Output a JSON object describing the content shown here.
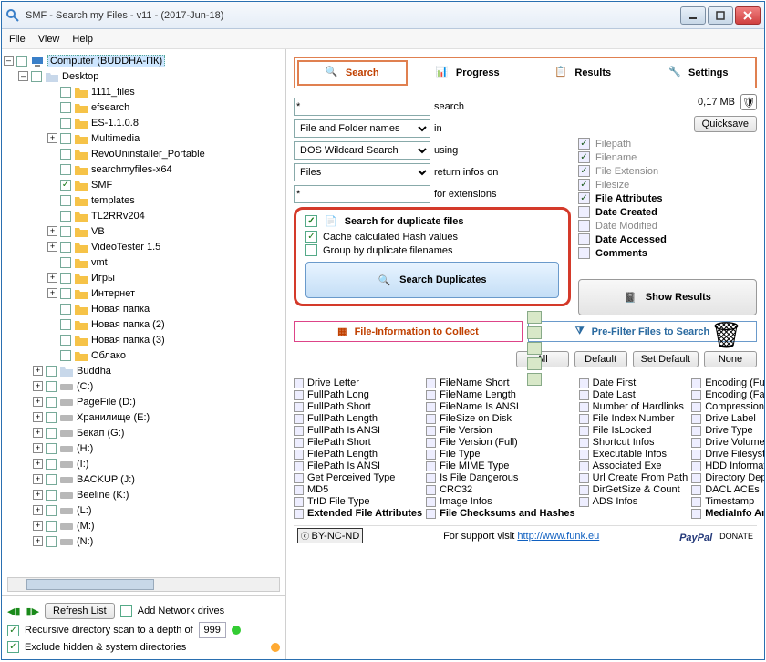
{
  "window": {
    "title": "SMF - Search my Files - v11 - (2017-Jun-18)"
  },
  "menu": {
    "file": "File",
    "view": "View",
    "help": "Help"
  },
  "tree": {
    "root": "Computer (BUDDHA-ПК)",
    "desktop": "Desktop",
    "folders": [
      "1111_files",
      "efsearch",
      "ES-1.1.0.8",
      "Multimedia",
      "RevoUninstaller_Portable",
      "searchmyfiles-x64",
      "SMF",
      "templates",
      "TL2RRv204",
      "VB",
      "VideoTester 1.5",
      "vmt",
      "Игры",
      "Интернет",
      "Новая папка",
      "Новая папка (2)",
      "Новая папка (3)",
      "Облако"
    ],
    "checked_folder": "SMF",
    "bottom": [
      "Buddha",
      "(C:)",
      "PageFile (D:)",
      "Хранилище (E:)",
      "Бекап (G:)",
      "(H:)",
      "(I:)",
      "BACKUP (J:)",
      "Beeline (K:)",
      "(L:)",
      "(M:)",
      "(N:)"
    ]
  },
  "left_bottom": {
    "refresh": "Refresh List",
    "add_net": "Add Network drives",
    "recursive": "Recursive directory scan to a depth of",
    "depth": "999",
    "exclude": "Exclude hidden & system directories"
  },
  "tabs": {
    "search": "Search",
    "progress": "Progress",
    "results": "Results",
    "settings": "Settings"
  },
  "search": {
    "pattern": "*",
    "lbl_search": "search",
    "in_opt": "File and Folder names",
    "lbl_in": "in",
    "using_opt": "DOS Wildcard Search",
    "lbl_using": "using",
    "return_opt": "Files",
    "lbl_return": "return infos on",
    "ext": "*",
    "lbl_ext": "for extensions"
  },
  "dup": {
    "head": "Search for duplicate files",
    "cache": "Cache calculated Hash values",
    "group": "Group by duplicate filenames",
    "btn": "Search Duplicates"
  },
  "checks": {
    "filepath": "Filepath",
    "filename": "Filename",
    "fileext": "File Extension",
    "filesize": "Filesize",
    "attrs": "File Attributes",
    "created": "Date Created",
    "modified": "Date Modified",
    "accessed": "Date Accessed",
    "comments": "Comments"
  },
  "topright": {
    "size": "0,17 MB",
    "quicksave": "Quicksave"
  },
  "show_results": "Show Results",
  "sections": {
    "collect": "File-Information to Collect",
    "prefilter": "Pre-Filter Files to Search"
  },
  "btns": {
    "all": "All",
    "default": "Default",
    "setdefault": "Set Default",
    "none": "None"
  },
  "grid": {
    "c1": [
      "Drive Letter",
      "FullPath Long",
      "FullPath Short",
      "FullPath Length",
      "FullPath Is ANSI",
      "FilePath Short",
      "FilePath Length",
      "FilePath Is ANSI",
      "Get Perceived Type",
      "MD5",
      "TrID File Type",
      "Extended File Attributes"
    ],
    "c2": [
      "FileName Short",
      "FileName Length",
      "FileName Is ANSI",
      "FileSize on Disk",
      "File Version",
      "File Version (Full)",
      "File Type",
      "File MIME Type",
      "Is File Dangerous",
      "CRC32",
      "Image Infos",
      "File Checksums and Hashes"
    ],
    "c3": [
      "Date First",
      "Date Last",
      "Number of Hardlinks",
      "File Index Number",
      "File IsLocked",
      "Shortcut Infos",
      "Executable Infos",
      "Associated Exe",
      "Url Create From Path",
      "DirGetSize & Count",
      "ADS Infos",
      ""
    ],
    "c4": [
      "Encoding (Full)",
      "Encoding (Fast)",
      "Compression State",
      "Drive Label",
      "Drive Type",
      "Drive Volume ID",
      "Drive Filesystem",
      "HDD Information",
      "Directory Depth",
      "DACL ACEs",
      "Timestamp",
      "MediaInfo Analysis"
    ]
  },
  "footer": {
    "support": "For support visit",
    "url": "http://www.funk.eu",
    "cc": "BY-NC-ND",
    "paypal": "PayPal",
    "donate": "DONATE"
  }
}
